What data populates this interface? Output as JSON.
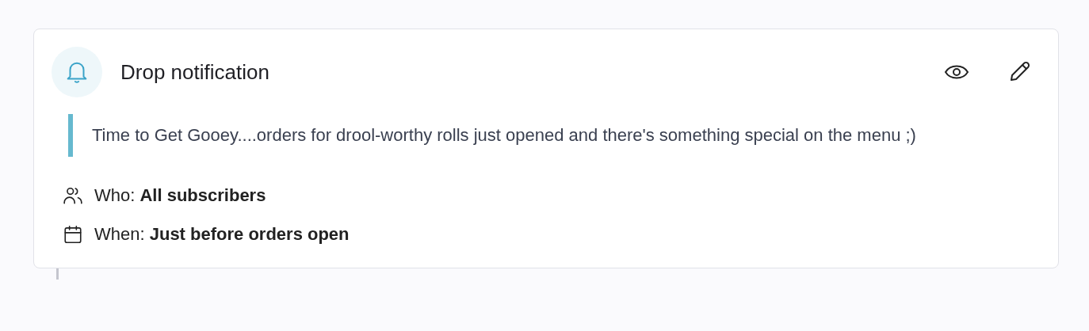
{
  "card": {
    "title": "Drop notification",
    "message": "Time to Get Gooey....orders for drool-worthy rolls just opened and there's something special on the menu ;)",
    "details": [
      {
        "kind": "who",
        "label": "Who:",
        "value": "All subscribers"
      },
      {
        "kind": "when",
        "label": "When:",
        "value": "Just before orders open"
      }
    ]
  }
}
